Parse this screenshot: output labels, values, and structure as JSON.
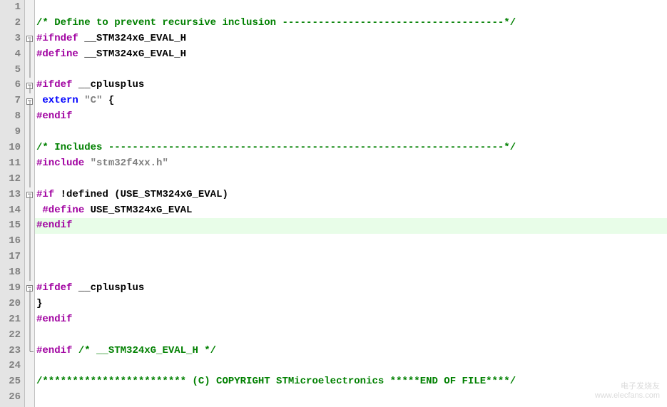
{
  "gutter": [
    "1",
    "2",
    "3",
    "4",
    "5",
    "6",
    "7",
    "8",
    "9",
    "10",
    "11",
    "12",
    "13",
    "14",
    "15",
    "16",
    "17",
    "18",
    "19",
    "20",
    "21",
    "22",
    "23",
    "24",
    "25",
    "26"
  ],
  "fold": {
    "3": "box-minus",
    "6": "box-minus",
    "7": "box-minus",
    "13": "box-minus",
    "19": "box-minus",
    "20": "end"
  },
  "lines": {
    "1": [
      {
        "cls": "",
        "t": ""
      }
    ],
    "2": [
      {
        "cls": "comment",
        "t": "/* Define to prevent recursive inclusion -------------------------------------*/"
      }
    ],
    "3": [
      {
        "cls": "preproc",
        "t": "#ifndef"
      },
      {
        "cls": "",
        "t": " "
      },
      {
        "cls": "ident",
        "t": "__STM324xG_EVAL_H"
      }
    ],
    "4": [
      {
        "cls": "preproc",
        "t": "#define"
      },
      {
        "cls": "",
        "t": " "
      },
      {
        "cls": "ident",
        "t": "__STM324xG_EVAL_H"
      }
    ],
    "5": [
      {
        "cls": "",
        "t": ""
      }
    ],
    "6": [
      {
        "cls": "preproc",
        "t": "#ifdef"
      },
      {
        "cls": "",
        "t": " "
      },
      {
        "cls": "ident",
        "t": "__cplusplus"
      }
    ],
    "7": [
      {
        "cls": "",
        "t": " "
      },
      {
        "cls": "keyword",
        "t": "extern"
      },
      {
        "cls": "",
        "t": " "
      },
      {
        "cls": "string",
        "t": "\"C\""
      },
      {
        "cls": "",
        "t": " "
      },
      {
        "cls": "punct",
        "t": "{"
      }
    ],
    "8": [
      {
        "cls": "preproc",
        "t": "#endif"
      }
    ],
    "9": [
      {
        "cls": "",
        "t": ""
      }
    ],
    "10": [
      {
        "cls": "comment",
        "t": "/* Includes ------------------------------------------------------------------*/"
      }
    ],
    "11": [
      {
        "cls": "preproc",
        "t": "#include"
      },
      {
        "cls": "",
        "t": " "
      },
      {
        "cls": "string",
        "t": "\"stm32f4xx.h\""
      }
    ],
    "12": [
      {
        "cls": "",
        "t": ""
      }
    ],
    "13": [
      {
        "cls": "preproc",
        "t": "#if"
      },
      {
        "cls": "",
        "t": " "
      },
      {
        "cls": "punct",
        "t": "!"
      },
      {
        "cls": "ident",
        "t": "defined"
      },
      {
        "cls": "",
        "t": " "
      },
      {
        "cls": "punct",
        "t": "("
      },
      {
        "cls": "ident",
        "t": "USE_STM324xG_EVAL"
      },
      {
        "cls": "punct",
        "t": ")"
      }
    ],
    "14": [
      {
        "cls": "",
        "t": " "
      },
      {
        "cls": "preproc",
        "t": "#define"
      },
      {
        "cls": "",
        "t": " "
      },
      {
        "cls": "ident",
        "t": "USE_STM324xG_EVAL"
      }
    ],
    "15": [
      {
        "cls": "preproc",
        "t": "#endif"
      }
    ],
    "16": [
      {
        "cls": "",
        "t": ""
      }
    ],
    "17": [
      {
        "cls": "",
        "t": ""
      }
    ],
    "18": [
      {
        "cls": "",
        "t": ""
      }
    ],
    "19": [
      {
        "cls": "preproc",
        "t": "#ifdef"
      },
      {
        "cls": "",
        "t": " "
      },
      {
        "cls": "ident",
        "t": "__cplusplus"
      }
    ],
    "20": [
      {
        "cls": "punct",
        "t": "}"
      }
    ],
    "21": [
      {
        "cls": "preproc",
        "t": "#endif"
      }
    ],
    "22": [
      {
        "cls": "",
        "t": ""
      }
    ],
    "23": [
      {
        "cls": "preproc",
        "t": "#endif"
      },
      {
        "cls": "",
        "t": " "
      },
      {
        "cls": "comment",
        "t": "/* __STM324xG_EVAL_H */"
      }
    ],
    "24": [
      {
        "cls": "",
        "t": ""
      }
    ],
    "25": [
      {
        "cls": "comment",
        "t": "/************************ (C) COPYRIGHT STMicroelectronics *****END OF FILE****/"
      }
    ],
    "26": [
      {
        "cls": "",
        "t": ""
      }
    ]
  },
  "highlighted_line": 15,
  "watermark": {
    "line1": "电子发烧友",
    "line2": "www.elecfans.com"
  }
}
